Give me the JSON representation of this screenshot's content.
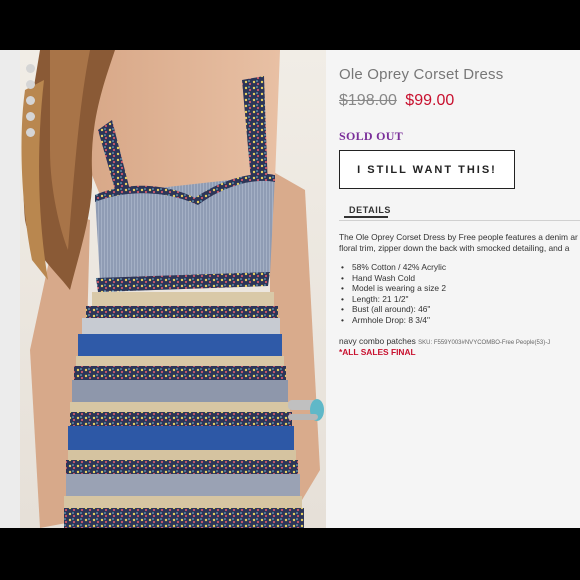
{
  "product": {
    "title": "Ole Oprey Corset Dress",
    "original_price": "$198.00",
    "sale_price": "$99.00",
    "status": "SOLD OUT",
    "want_button": "I STILL WANT THIS!",
    "details_tab": "DETAILS",
    "description_line1": "The Ole Oprey Corset Dress by Free people features a denim ar",
    "description_line2": "floral trim, zipper down the back with smocked detailing, and a",
    "specs": [
      "58% Cotton / 42% Acrylic",
      "Hand Wash Cold",
      "Model is wearing a size 2",
      "Length: 21 1/2\"",
      "Bust (all around): 46\"",
      "Armhole Drop: 8 3/4\""
    ],
    "color_name": "navy combo patches",
    "sku": "SKU: F559Y003#NVYCOMBO-Free People(53)-J",
    "final_sale": "*ALL SALES FINAL"
  },
  "colors": {
    "sale_red": "#c8102e",
    "sold_out_purple": "#7a2f9a"
  }
}
